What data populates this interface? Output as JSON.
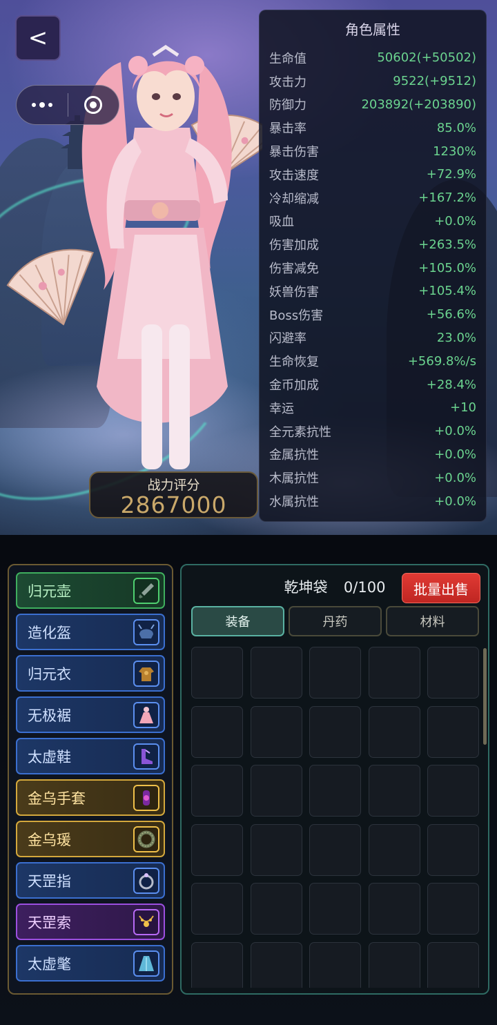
{
  "nav": {
    "back_label": "<"
  },
  "power": {
    "label": "战力评分",
    "value": "2867000"
  },
  "attributes": {
    "title": "角色属性",
    "rows": [
      {
        "name": "生命值",
        "value": "50602(+50502)"
      },
      {
        "name": "攻击力",
        "value": "9522(+9512)"
      },
      {
        "name": "防御力",
        "value": "203892(+203890)"
      },
      {
        "name": "暴击率",
        "value": "85.0%"
      },
      {
        "name": "暴击伤害",
        "value": "1230%"
      },
      {
        "name": "攻击速度",
        "value": "+72.9%"
      },
      {
        "name": "冷却缩减",
        "value": "+167.2%"
      },
      {
        "name": "吸血",
        "value": "+0.0%"
      },
      {
        "name": "伤害加成",
        "value": "+263.5%"
      },
      {
        "name": "伤害减免",
        "value": "+105.0%"
      },
      {
        "name": "妖兽伤害",
        "value": "+105.4%"
      },
      {
        "name": "Boss伤害",
        "value": "+56.6%"
      },
      {
        "name": "闪避率",
        "value": "23.0%"
      },
      {
        "name": "生命恢复",
        "value": "+569.8%/s"
      },
      {
        "name": "金币加成",
        "value": "+28.4%"
      },
      {
        "name": "幸运",
        "value": "+10"
      },
      {
        "name": "全元素抗性",
        "value": "+0.0%"
      },
      {
        "name": "金属抗性",
        "value": "+0.0%"
      },
      {
        "name": "木属抗性",
        "value": "+0.0%"
      },
      {
        "name": "水属抗性",
        "value": "+0.0%"
      }
    ]
  },
  "equipment": [
    {
      "label": "归元壶",
      "quality": "green",
      "icon": "sword-icon"
    },
    {
      "label": "造化盔",
      "quality": "blue",
      "icon": "helmet-icon"
    },
    {
      "label": "归元衣",
      "quality": "blue",
      "icon": "armor-icon"
    },
    {
      "label": "无极裾",
      "quality": "blue",
      "icon": "skirt-icon"
    },
    {
      "label": "太虚鞋",
      "quality": "blue",
      "icon": "boots-icon"
    },
    {
      "label": "金乌手套",
      "quality": "gold",
      "icon": "gloves-icon"
    },
    {
      "label": "金乌瑗",
      "quality": "gold",
      "icon": "bracelet-icon"
    },
    {
      "label": "天罡指",
      "quality": "blue",
      "icon": "ring-icon"
    },
    {
      "label": "天罡索",
      "quality": "purple",
      "icon": "necklace-icon"
    },
    {
      "label": "太虚氅",
      "quality": "blue",
      "icon": "cloak-icon"
    }
  ],
  "bag": {
    "title": "乾坤袋",
    "count": "0/100",
    "sell_label": "批量出售",
    "tabs": [
      {
        "label": "装备",
        "active": true
      },
      {
        "label": "丹药",
        "active": false
      },
      {
        "label": "材料",
        "active": false
      }
    ]
  },
  "colors": {
    "attr_value": "#6bd48f",
    "power_value": "#c9a86a",
    "sell_button": "#d23029",
    "quality_green": "#3faf5e",
    "quality_blue": "#3b6fd0",
    "quality_gold": "#d4a83c",
    "quality_purple": "#9c4fe0"
  }
}
